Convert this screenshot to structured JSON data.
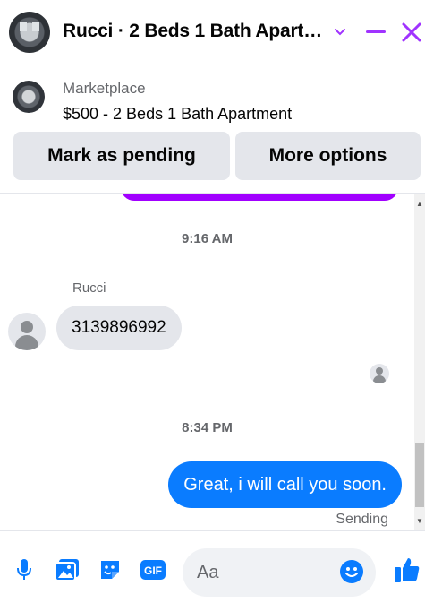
{
  "header": {
    "title": "Rucci · 2 Beds 1 Bath Apart…",
    "chevron_icon": "chevron-down-icon",
    "minimize_icon": "minimize-icon",
    "close_icon": "close-icon",
    "accent_color": "#a033ff"
  },
  "listing": {
    "label": "Marketplace",
    "price_title": "$500 - 2 Beds 1 Bath Apartment",
    "mark_pending_label": "Mark as pending",
    "more_options_label": "More options"
  },
  "messages": {
    "timestamp_1": "9:16 AM",
    "sender_name": "Rucci",
    "received_text": "3139896992",
    "timestamp_2": "8:34 PM",
    "sent_text": "Great, i will call you soon.",
    "sent_status": "Sending",
    "sent_bubble_color": "#0a7cff",
    "prev_bubble_color": "#a100ff"
  },
  "composer": {
    "placeholder": "Aa",
    "icons": [
      "microphone-icon",
      "photo-icon",
      "sticker-icon",
      "gif-icon",
      "emoji-icon",
      "thumbs-up-icon"
    ],
    "gif_label": "GIF",
    "icon_color": "#0a7cff"
  }
}
